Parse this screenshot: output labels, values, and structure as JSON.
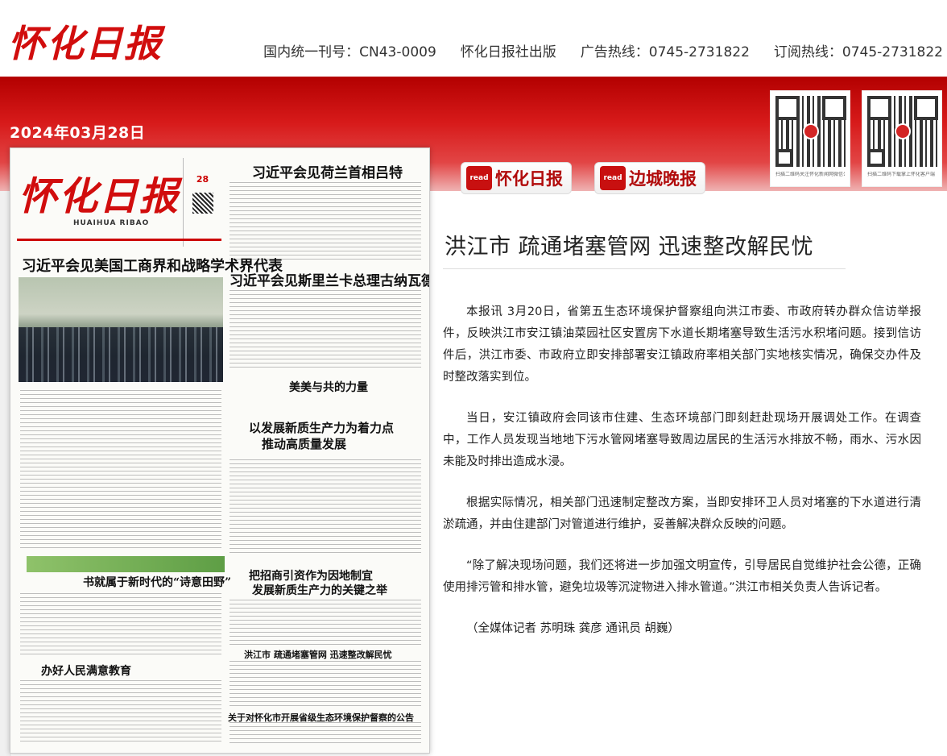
{
  "site": {
    "logo_text": "怀化日报",
    "publication_code": "国内统一刊号：CN43-0009",
    "publisher": "怀化日报社出版",
    "ad_hotline": "广告热线：0745-2731822",
    "subscription_hotline": "订阅热线：0745-2731822"
  },
  "issue": {
    "date": "2024年03月28日"
  },
  "qr_codes": [
    {
      "caption": "扫描二维码关注怀化新闻网微信公众号"
    },
    {
      "caption": "扫描二维码下载掌上怀化客户端"
    }
  ],
  "read_buttons": [
    {
      "icon_text": "read",
      "label": "怀化日报"
    },
    {
      "icon_text": "read",
      "label": "边城晚报"
    }
  ],
  "newspaper_page": {
    "masthead": "怀化日报",
    "pinyin": "HUAIHUA RIBAO",
    "day": "28",
    "headlines": [
      "习近平会见美国工商界和战略学术界代表",
      "习近平会见荷兰首相吕特",
      "习近平会见斯里兰卡总理古纳瓦德纳",
      "美美与共的力量",
      "以发展新质生产力为着力点",
      "推动高质量发展",
      "把招商引资作为因地制宜",
      "发展新质生产力的关键之举",
      "书就属于新时代的“诗意田野”",
      "办好人民满意教育",
      "洪江市 疏通堵塞管网 迅速整改解民忧",
      "关于对怀化市开展省级生态环境保护督察的公告"
    ]
  },
  "article": {
    "title": "洪江市 疏通堵塞管网 迅速整改解民忧",
    "paragraphs": [
      "本报讯 3月20日，省第五生态环境保护督察组向洪江市委、市政府转办群众信访举报件，反映洪江市安江镇油菜园社区安置房下水道长期堵塞导致生活污水积堵问题。接到信访件后，洪江市委、市政府立即安排部署安江镇政府率相关部门实地核实情况，确保交办件及时整改落实到位。",
      "当日，安江镇政府会同该市住建、生态环境部门即刻赶赴现场开展调处工作。在调查中，工作人员发现当地地下污水管网堵塞导致周边居民的生活污水排放不畅，雨水、污水因未能及时排出造成水浸。",
      "根据实际情况，相关部门迅速制定整改方案，当即安排环卫人员对堵塞的下水道进行清淤疏通，并由住建部门对管道进行维护，妥善解决群众反映的问题。",
      "“除了解决现场问题，我们还将进一步加强文明宣传，引导居民自觉维护社会公德，正确使用排污管和排水管，避免垃圾等沉淀物进入排水管道。”洪江市相关负责人告诉记者。",
      "（全媒体记者 苏明珠 龚彦 通讯员 胡巍）"
    ]
  },
  "colors": {
    "brand_red": "#d10d0d",
    "banner_red": "#c81010"
  }
}
